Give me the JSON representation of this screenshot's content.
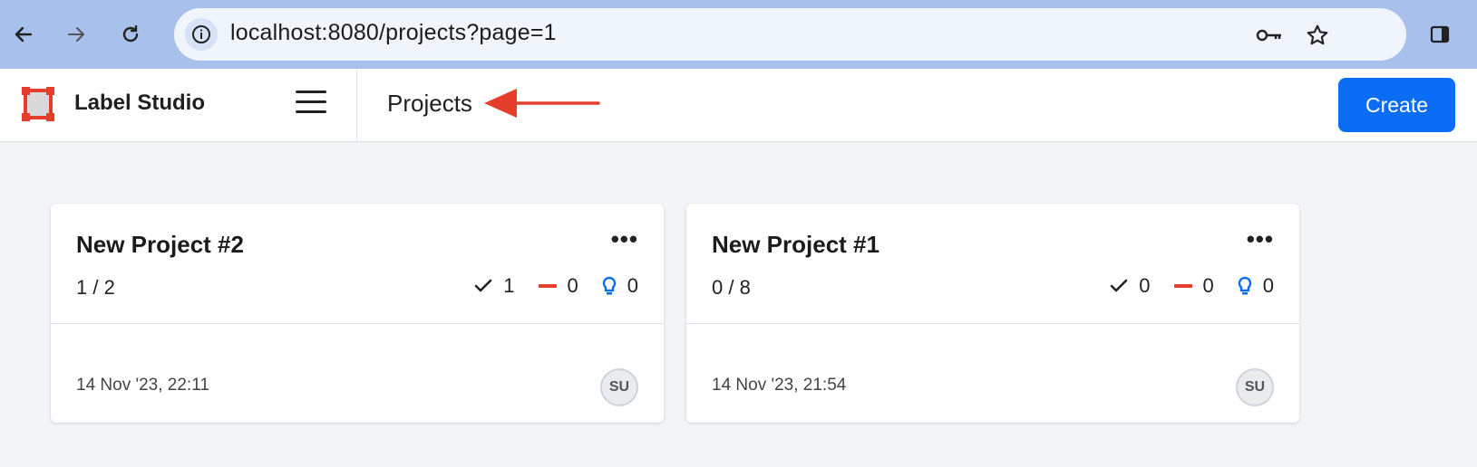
{
  "browser": {
    "url": "localhost:8080/projects?page=1",
    "icons": [
      "back-arrow-icon",
      "forward-arrow-icon",
      "reload-icon",
      "site-info-icon",
      "key-icon",
      "star-icon",
      "sidebar-icon"
    ]
  },
  "app": {
    "name": "Label Studio",
    "page_title": "Projects",
    "create_label": "Create",
    "colors": {
      "accent": "#0b6cf5",
      "logo": "#e53e2c",
      "annotation_arrow": "#e53e2c"
    }
  },
  "projects": [
    {
      "title": "New Project #2",
      "progress": "1 / 2",
      "completed": "1",
      "skipped": "0",
      "predictions": "0",
      "date": "14 Nov '23, 22:11",
      "avatar": "SU"
    },
    {
      "title": "New Project #1",
      "progress": "0 / 8",
      "completed": "0",
      "skipped": "0",
      "predictions": "0",
      "date": "14 Nov '23, 21:54",
      "avatar": "SU"
    }
  ]
}
